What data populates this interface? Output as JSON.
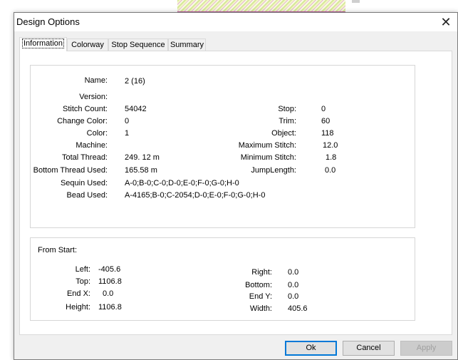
{
  "window": {
    "title": "Design Options",
    "close_glyph": "✕"
  },
  "tabs": [
    {
      "label": "Information",
      "active": true
    },
    {
      "label": "Colorway",
      "active": false
    },
    {
      "label": "Stop Sequence",
      "active": false
    },
    {
      "label": "Summary",
      "active": false
    }
  ],
  "info": {
    "name_label": "Name:",
    "name": "2 (16)",
    "version_label": "Version:",
    "version": "",
    "stitch_count_label": "Stitch Count:",
    "stitch_count": "54042",
    "change_color_label": "Change Color:",
    "change_color": "0",
    "color_label": "Color:",
    "color": "1",
    "machine_label": "Machine:",
    "machine": "",
    "total_thread_label": "Total Thread:",
    "total_thread": "249. 12 m",
    "bottom_thread_label": "Bottom Thread Used:",
    "bottom_thread": "165.58 m",
    "sequin_label": "Sequin Used:",
    "sequin": "A-0;B-0;C-0;D-0;E-0;F-0;G-0;H-0",
    "bead_label": "Bead Used:",
    "bead": "A-4165;B-0;C-2054;D-0;E-0;F-0;G-0;H-0",
    "stop_label": "Stop:",
    "stop": "0",
    "trim_label": "Trim:",
    "trim": "60",
    "object_label": "Object:",
    "object": "118",
    "max_stitch_label": "Maximum Stitch:",
    "max_stitch": "12.0",
    "min_stitch_label": "Minimum Stitch:",
    "min_stitch": "1.8",
    "jump_length_label": "JumpLength:",
    "jump_length": "0.0"
  },
  "from_start": {
    "heading": "From Start:",
    "left_label": "Left:",
    "left": "-405.6",
    "top_label": "Top:",
    "top": "1106.8",
    "endx_label": "End X:",
    "endx": "0.0",
    "height_label": "Height:",
    "height": "1106.8",
    "right_label": "Right:",
    "right": "0.0",
    "bottom_label": "Bottom:",
    "bottom": "0.0",
    "endy_label": "End Y:",
    "endy": "0.0",
    "width_label": "Width:",
    "width": "405.6"
  },
  "buttons": {
    "ok": "Ok",
    "cancel": "Cancel",
    "apply": "Apply"
  }
}
